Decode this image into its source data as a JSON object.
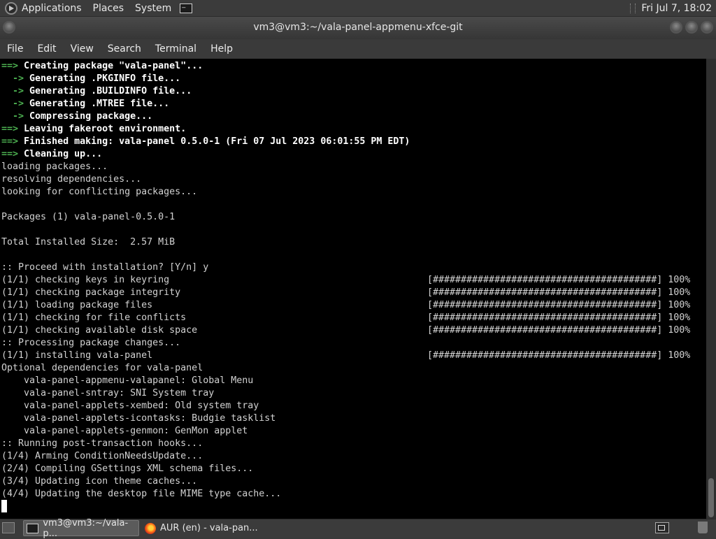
{
  "top_panel": {
    "menus": [
      "Applications",
      "Places",
      "System"
    ],
    "clock": "Fri Jul  7, 18:02"
  },
  "window": {
    "title": "vm3@vm3:~/vala-panel-appmenu-xfce-git"
  },
  "menubar": [
    "File",
    "Edit",
    "View",
    "Search",
    "Terminal",
    "Help"
  ],
  "terminal": {
    "lines": [
      {
        "prefix": "==>",
        "text": " Creating package \"vala-panel\"...",
        "bold": true
      },
      {
        "prefix": "  ->",
        "text": " Generating .PKGINFO file...",
        "bold": true
      },
      {
        "prefix": "  ->",
        "text": " Generating .BUILDINFO file...",
        "bold": true
      },
      {
        "prefix": "  ->",
        "text": " Generating .MTREE file...",
        "bold": true
      },
      {
        "prefix": "  ->",
        "text": " Compressing package...",
        "bold": true
      },
      {
        "prefix": "==>",
        "text": " Leaving fakeroot environment.",
        "bold": true
      },
      {
        "prefix": "==>",
        "text": " Finished making: vala-panel 0.5.0-1 (Fri 07 Jul 2023 06:01:55 PM EDT)",
        "bold": true
      },
      {
        "prefix": "==>",
        "text": " Cleaning up...",
        "bold": true
      },
      {
        "prefix": "",
        "text": "loading packages...",
        "bold": false
      },
      {
        "prefix": "",
        "text": "resolving dependencies...",
        "bold": false
      },
      {
        "prefix": "",
        "text": "looking for conflicting packages...",
        "bold": false
      },
      {
        "prefix": "",
        "text": "",
        "bold": false
      },
      {
        "prefix": "",
        "text": "Packages (1) vala-panel-0.5.0-1",
        "bold": false
      },
      {
        "prefix": "",
        "text": "",
        "bold": false
      },
      {
        "prefix": "",
        "text": "Total Installed Size:  2.57 MiB",
        "bold": false
      },
      {
        "prefix": "",
        "text": "",
        "bold": false
      },
      {
        "prefix": "",
        "text": ":: Proceed with installation? [Y/n] y",
        "bold": false
      },
      {
        "prefix": "",
        "text": "(1/1) checking keys in keyring",
        "bold": false,
        "progress": "[########################################] 100%"
      },
      {
        "prefix": "",
        "text": "(1/1) checking package integrity",
        "bold": false,
        "progress": "[########################################] 100%"
      },
      {
        "prefix": "",
        "text": "(1/1) loading package files",
        "bold": false,
        "progress": "[########################################] 100%"
      },
      {
        "prefix": "",
        "text": "(1/1) checking for file conflicts",
        "bold": false,
        "progress": "[########################################] 100%"
      },
      {
        "prefix": "",
        "text": "(1/1) checking available disk space",
        "bold": false,
        "progress": "[########################################] 100%"
      },
      {
        "prefix": "",
        "text": ":: Processing package changes...",
        "bold": false
      },
      {
        "prefix": "",
        "text": "(1/1) installing vala-panel",
        "bold": false,
        "progress": "[########################################] 100%"
      },
      {
        "prefix": "",
        "text": "Optional dependencies for vala-panel",
        "bold": false
      },
      {
        "prefix": "",
        "text": "    vala-panel-appmenu-valapanel: Global Menu",
        "bold": false
      },
      {
        "prefix": "",
        "text": "    vala-panel-sntray: SNI System tray",
        "bold": false
      },
      {
        "prefix": "",
        "text": "    vala-panel-applets-xembed: Old system tray",
        "bold": false
      },
      {
        "prefix": "",
        "text": "    vala-panel-applets-icontasks: Budgie tasklist",
        "bold": false
      },
      {
        "prefix": "",
        "text": "    vala-panel-applets-genmon: GenMon applet",
        "bold": false
      },
      {
        "prefix": "",
        "text": ":: Running post-transaction hooks...",
        "bold": false
      },
      {
        "prefix": "",
        "text": "(1/4) Arming ConditionNeedsUpdate...",
        "bold": false
      },
      {
        "prefix": "",
        "text": "(2/4) Compiling GSettings XML schema files...",
        "bold": false
      },
      {
        "prefix": "",
        "text": "(3/4) Updating icon theme caches...",
        "bold": false
      },
      {
        "prefix": "",
        "text": "(4/4) Updating the desktop file MIME type cache...",
        "bold": false
      }
    ]
  },
  "taskbar": {
    "tasks": [
      {
        "label": "vm3@vm3:~/vala-p...",
        "icon": "terminal-icon",
        "active": true
      },
      {
        "label": "AUR (en) - vala-pan...",
        "icon": "firefox-icon",
        "active": false
      }
    ]
  }
}
